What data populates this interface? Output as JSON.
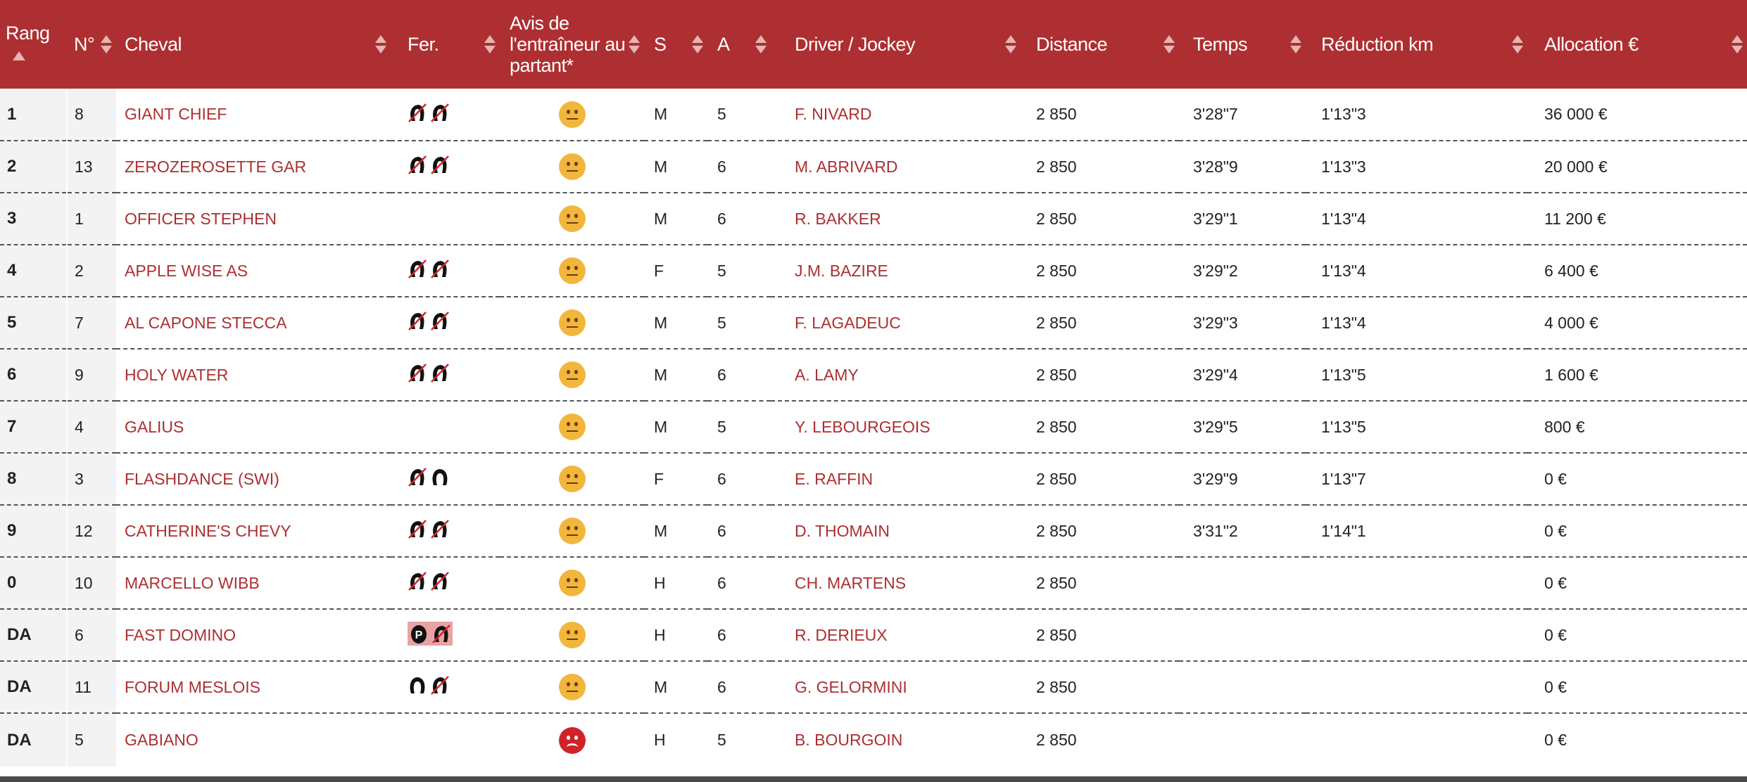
{
  "headers": {
    "rang": "Rang",
    "num": "N°",
    "cheval": "Cheval",
    "fer": "Fer.",
    "avis": "Avis de l'entraîneur au partant*",
    "s": "S",
    "a": "A",
    "driver": "Driver / Jockey",
    "distance": "Distance",
    "temps": "Temps",
    "reduction": "Réduction km",
    "allocation": "Allocation €"
  },
  "sort": {
    "column": "rang",
    "direction": "ascending"
  },
  "colors": {
    "header_bg": "#ad2f31",
    "link": "#ad2f31",
    "neutral": "#f3b63c",
    "sad": "#cf2229"
  },
  "rows": [
    {
      "rang": "1",
      "num": "8",
      "cheval": "GIANT CHIEF",
      "fer": [
        "barefoot",
        "barefoot"
      ],
      "avis": "neutral-face-icon",
      "s": "M",
      "a": "5",
      "driver": "F. NIVARD",
      "distance": "2 850",
      "temps": "3'28\"7",
      "reduction": "1'13\"3",
      "allocation": "36 000 €"
    },
    {
      "rang": "2",
      "num": "13",
      "cheval": "ZEROZEROSETTE GAR",
      "fer": [
        "barefoot",
        "barefoot"
      ],
      "avis": "neutral-face-icon",
      "s": "M",
      "a": "6",
      "driver": "M. ABRIVARD",
      "distance": "2 850",
      "temps": "3'28\"9",
      "reduction": "1'13\"3",
      "allocation": "20 000 €"
    },
    {
      "rang": "3",
      "num": "1",
      "cheval": "OFFICER STEPHEN",
      "fer": [],
      "avis": "neutral-face-icon",
      "s": "M",
      "a": "6",
      "driver": "R. BAKKER",
      "distance": "2 850",
      "temps": "3'29\"1",
      "reduction": "1'13\"4",
      "allocation": "11 200 €"
    },
    {
      "rang": "4",
      "num": "2",
      "cheval": "APPLE WISE AS",
      "fer": [
        "barefoot",
        "barefoot"
      ],
      "avis": "neutral-face-icon",
      "s": "F",
      "a": "5",
      "driver": "J.M. BAZIRE",
      "distance": "2 850",
      "temps": "3'29\"2",
      "reduction": "1'13\"4",
      "allocation": "6 400 €"
    },
    {
      "rang": "5",
      "num": "7",
      "cheval": "AL CAPONE STECCA",
      "fer": [
        "barefoot",
        "barefoot"
      ],
      "avis": "neutral-face-icon",
      "s": "M",
      "a": "5",
      "driver": "F. LAGADEUC",
      "distance": "2 850",
      "temps": "3'29\"3",
      "reduction": "1'13\"4",
      "allocation": "4 000 €"
    },
    {
      "rang": "6",
      "num": "9",
      "cheval": "HOLY WATER",
      "fer": [
        "barefoot",
        "barefoot"
      ],
      "avis": "neutral-face-icon",
      "s": "M",
      "a": "6",
      "driver": "A. LAMY",
      "distance": "2 850",
      "temps": "3'29\"4",
      "reduction": "1'13\"5",
      "allocation": "1 600 €"
    },
    {
      "rang": "7",
      "num": "4",
      "cheval": "GALIUS",
      "fer": [],
      "avis": "neutral-face-icon",
      "s": "M",
      "a": "5",
      "driver": "Y. LEBOURGEOIS",
      "distance": "2 850",
      "temps": "3'29\"5",
      "reduction": "1'13\"5",
      "allocation": "800 €"
    },
    {
      "rang": "8",
      "num": "3",
      "cheval": "FLASHDANCE (SWI)",
      "fer": [
        "barefoot",
        "shod"
      ],
      "avis": "neutral-face-icon",
      "s": "F",
      "a": "6",
      "driver": "E. RAFFIN",
      "distance": "2 850",
      "temps": "3'29\"9",
      "reduction": "1'13\"7",
      "allocation": "0 €"
    },
    {
      "rang": "9",
      "num": "12",
      "cheval": "CATHERINE'S CHEVY",
      "fer": [
        "barefoot",
        "barefoot"
      ],
      "avis": "neutral-face-icon",
      "s": "M",
      "a": "6",
      "driver": "D. THOMAIN",
      "distance": "2 850",
      "temps": "3'31\"2",
      "reduction": "1'14\"1",
      "allocation": "0 €"
    },
    {
      "rang": "0",
      "num": "10",
      "cheval": "MARCELLO WIBB",
      "fer": [
        "barefoot",
        "barefoot"
      ],
      "avis": "neutral-face-icon",
      "s": "H",
      "a": "6",
      "driver": "CH. MARTENS",
      "distance": "2 850",
      "temps": "",
      "reduction": "",
      "allocation": "0 €"
    },
    {
      "rang": "DA",
      "num": "6",
      "cheval": "FAST DOMINO",
      "fer": [
        "plate",
        "barefoot"
      ],
      "fer_highlight": true,
      "avis": "neutral-face-icon",
      "s": "H",
      "a": "6",
      "driver": "R. DERIEUX",
      "distance": "2 850",
      "temps": "",
      "reduction": "",
      "allocation": "0 €"
    },
    {
      "rang": "DA",
      "num": "11",
      "cheval": "FORUM MESLOIS",
      "fer": [
        "shod",
        "barefoot"
      ],
      "avis": "neutral-face-icon",
      "s": "M",
      "a": "6",
      "driver": "G. GELORMINI",
      "distance": "2 850",
      "temps": "",
      "reduction": "",
      "allocation": "0 €"
    },
    {
      "rang": "DA",
      "num": "5",
      "cheval": "GABIANO",
      "fer": [],
      "avis": "sad-face-icon",
      "s": "H",
      "a": "5",
      "driver": "B. BOURGOIN",
      "distance": "2 850",
      "temps": "",
      "reduction": "",
      "allocation": "0 €"
    }
  ]
}
